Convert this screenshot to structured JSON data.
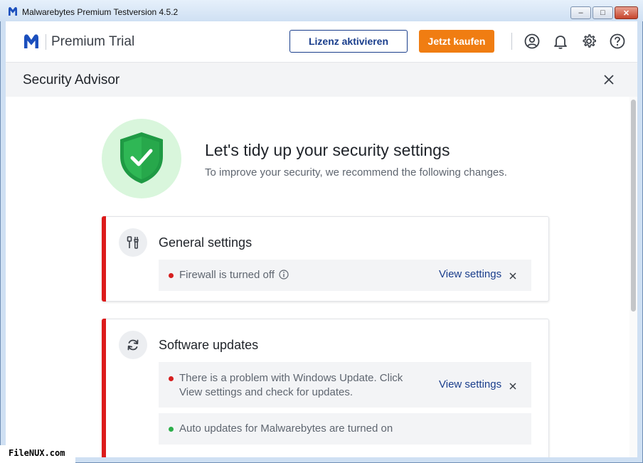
{
  "window": {
    "title": "Malwarebytes Premium Testversion  4.5.2"
  },
  "header": {
    "plan_title": "Premium Trial",
    "activate_label": "Lizenz aktivieren",
    "buy_label": "Jetzt kaufen",
    "icons": [
      "account-icon",
      "bell-icon",
      "gear-icon",
      "help-icon"
    ]
  },
  "advisor": {
    "title": "Security Advisor"
  },
  "hero": {
    "title": "Let's tidy up your security settings",
    "subtitle": "To improve your security, we recommend the following changes."
  },
  "cards": [
    {
      "title": "General settings",
      "icon": "tools-icon",
      "items": [
        {
          "text": "Firewall is turned off",
          "status": "red",
          "link": "View settings",
          "has_info": true
        }
      ]
    },
    {
      "title": "Software updates",
      "icon": "refresh-icon",
      "items": [
        {
          "line1": "There is a problem with Windows Update. Click",
          "line2": "View settings and check for updates.",
          "status": "red",
          "link": "View settings"
        },
        {
          "text": "Auto updates for Malwarebytes are turned on",
          "status": "green"
        }
      ]
    }
  ],
  "colors": {
    "accent_red": "#dc1b1b",
    "brand_blue": "#1a3e8c",
    "buy_orange": "#f07d12",
    "ok_green": "#2cae4a"
  },
  "watermark": "FileNUX.com"
}
